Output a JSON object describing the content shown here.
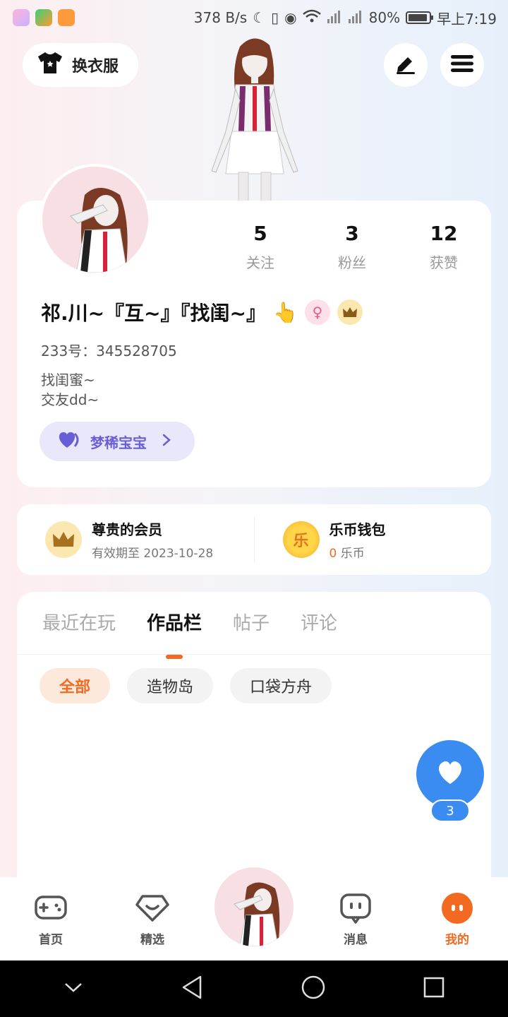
{
  "status_bar": {
    "speed": "378 B/s",
    "battery": "80%",
    "time": "早上7:19"
  },
  "header": {
    "outfit_label": "换衣服",
    "edit_icon": "pencil-icon",
    "menu_icon": "hamburger-icon"
  },
  "profile": {
    "stats": [
      {
        "value": "5",
        "label": "关注"
      },
      {
        "value": "3",
        "label": "粉丝"
      },
      {
        "value": "12",
        "label": "获赞"
      }
    ],
    "nickname": "祁.川~『互~』『找闺~』",
    "emoji": "👆",
    "gender_badge": "♀",
    "uid": "233号：345528705",
    "bio_line1": "找闺蜜~",
    "bio_line2": "交友dd~",
    "pet_label": "梦稀宝宝"
  },
  "membership": {
    "vip_title": "尊贵的会员",
    "vip_expiry": "有效期至 2023-10-28",
    "wallet_title": "乐币钱包",
    "wallet_amount": "0",
    "wallet_unit": "乐币",
    "coin_char": "乐"
  },
  "content": {
    "tabs": [
      "最近在玩",
      "作品栏",
      "帖子",
      "评论"
    ],
    "active_tab": "作品栏",
    "chips": [
      "全部",
      "造物岛",
      "口袋方舟"
    ],
    "like_count": "3"
  },
  "bottom_nav": {
    "items": [
      "首页",
      "精选",
      "消息",
      "我的"
    ],
    "active": "我的"
  },
  "colors": {
    "accent": "#f26a21",
    "like_blue": "#3b8cf0",
    "pet_purple": "#6a5ed6"
  }
}
